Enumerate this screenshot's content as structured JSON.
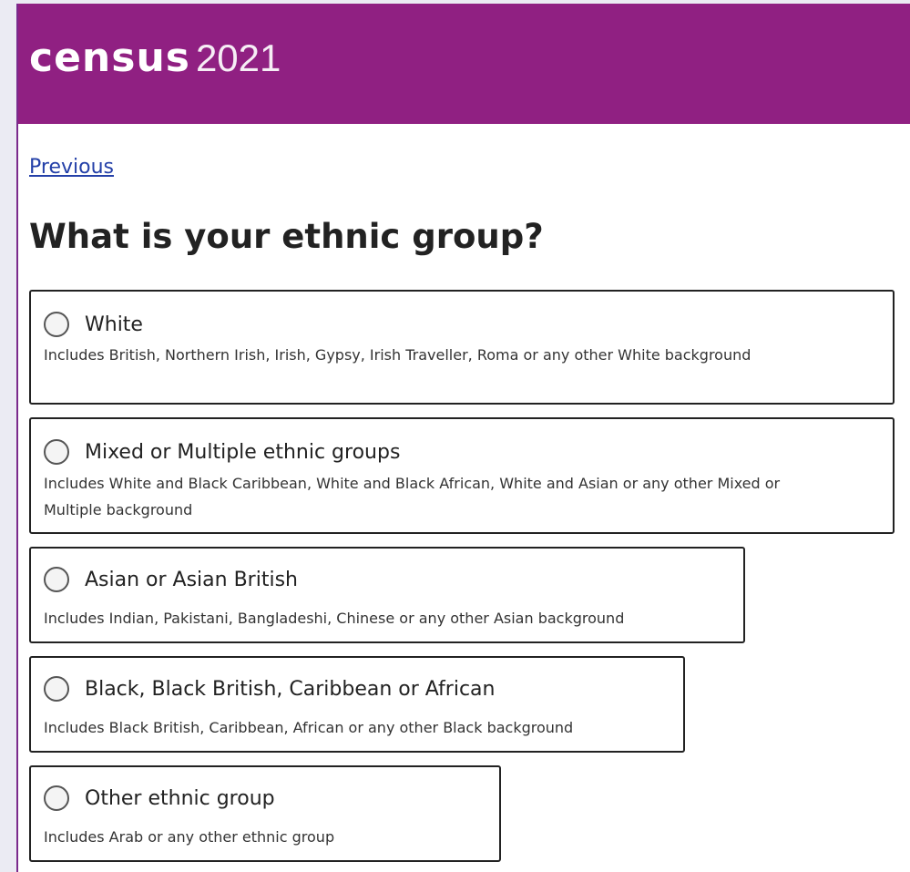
{
  "header": {
    "logo_word": "census",
    "logo_year": "2021",
    "background_color": "#902082"
  },
  "nav": {
    "previous_label": "Previous"
  },
  "question": {
    "title": "What is your ethnic group?"
  },
  "options": [
    {
      "label": "White",
      "description": "Includes British, Northern Irish, Irish, Gypsy, Irish Traveller, Roma or any other White background",
      "selected": false
    },
    {
      "label": "Mixed or Multiple ethnic groups",
      "description": "Includes White and Black Caribbean, White and Black African, White and Asian or any other Mixed or Multiple background",
      "selected": false
    },
    {
      "label": "Asian or Asian British",
      "description": "Includes Indian, Pakistani, Bangladeshi, Chinese or any other Asian background",
      "selected": false
    },
    {
      "label": "Black, Black British, Caribbean or African",
      "description": "Includes Black British, Caribbean, African or any other Black background",
      "selected": false
    },
    {
      "label": "Other ethnic group",
      "description": "Includes Arab or any other ethnic group",
      "selected": false
    }
  ]
}
